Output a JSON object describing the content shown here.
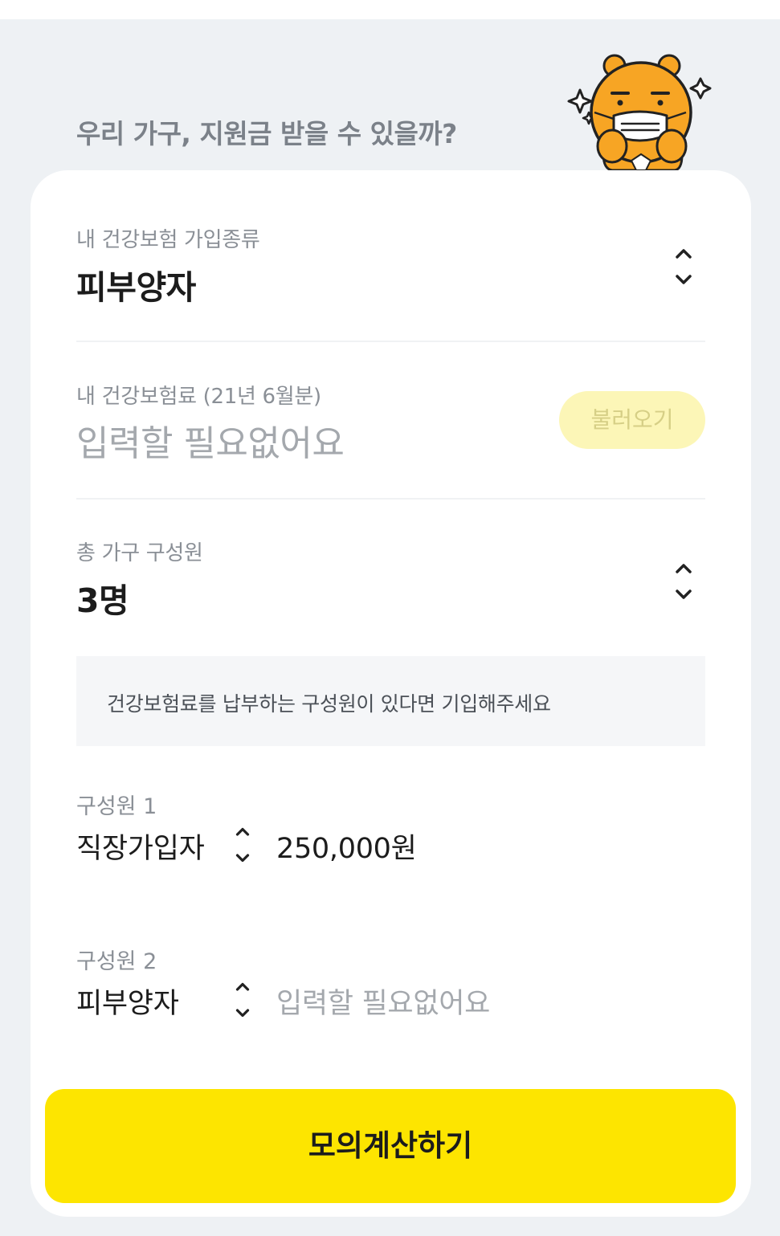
{
  "headline": "우리 가구, 지원금 받을 수 있을까?",
  "mascot": {
    "icon": "ryan-mask-mascot-icon"
  },
  "insurance_type": {
    "label": "내 건강보험 가입종류",
    "value": "피부양자",
    "icon": "chevron-up-down-icon"
  },
  "premium": {
    "label": "내 건강보험료 (21년 6월분)",
    "value": "입력할 필요없어요",
    "load_button": "불러오기"
  },
  "household": {
    "label": "총 가구 구성원",
    "value": "3명",
    "icon": "chevron-up-down-icon"
  },
  "notice": "건강보험료를 납부하는 구성원이 있다면 기입해주세요",
  "members": [
    {
      "label": "구성원 1",
      "type": "직장가입자",
      "amount": "250,000원"
    },
    {
      "label": "구성원 2",
      "type": "피부양자",
      "amount": "입력할 필요없어요"
    }
  ],
  "submit_label": "모의계산하기",
  "colors": {
    "background": "#eef1f4",
    "card": "#ffffff",
    "accent_yellow": "#fde500",
    "load_button_bg": "#fcf6b7",
    "muted_text": "#a4a8ad"
  }
}
